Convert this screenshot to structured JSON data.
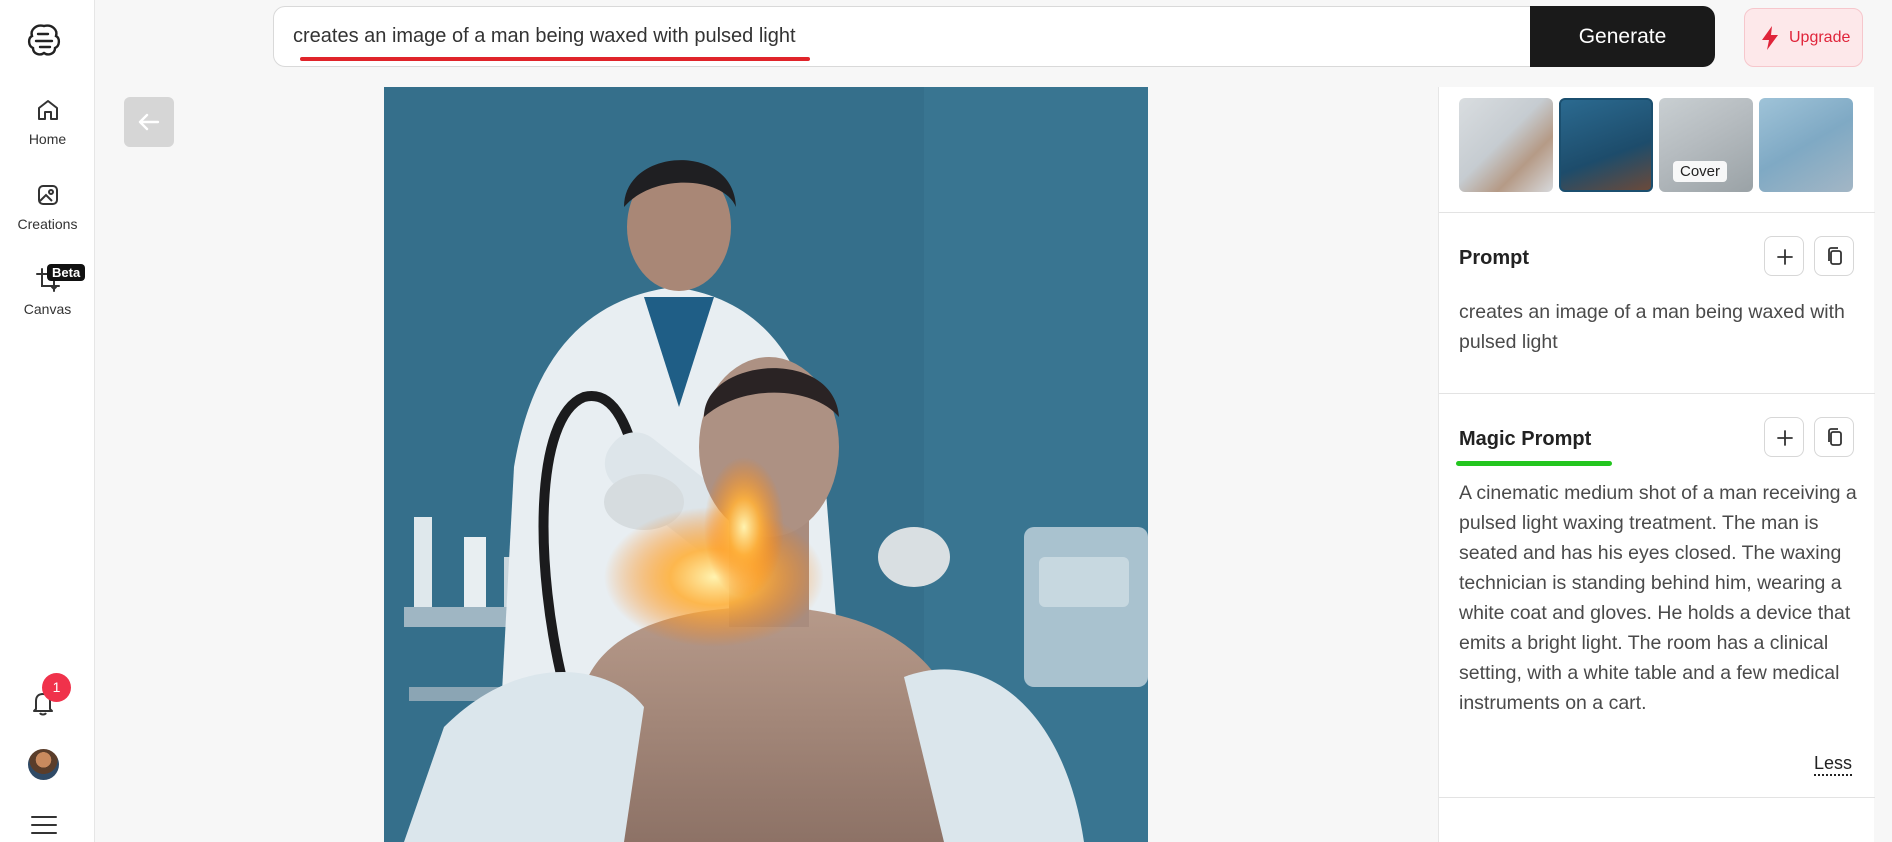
{
  "sidebar": {
    "logo_icon": "brain-logo-icon",
    "items": [
      {
        "label": "Home",
        "icon": "home-icon"
      },
      {
        "label": "Creations",
        "icon": "image-icon"
      },
      {
        "label": "Canvas",
        "icon": "crop-icon",
        "badge": "Beta"
      }
    ],
    "notification_count": "1"
  },
  "search": {
    "value": "creates an image of a man being waxed with pulsed light",
    "generate_label": "Generate",
    "upgrade_label": "Upgrade"
  },
  "thumbnails": {
    "cover_label": "Cover"
  },
  "prompt": {
    "title": "Prompt",
    "text": "creates an image of a man being waxed with pulsed light"
  },
  "magic_prompt": {
    "title": "Magic Prompt",
    "text": "A cinematic medium shot of a man receiving a pulsed light waxing treatment. The man is seated and has his eyes closed. The waxing technician is standing behind him, wearing a white coat and gloves. He holds a device that emits a bright light. The room has a clinical setting, with a white table and a few medical instruments on a cart.",
    "less_label": "Less"
  },
  "colors": {
    "accent_red": "#e0242a",
    "accent_green": "#23c51f",
    "generate_bg": "#1a1a1a",
    "upgrade_bg": "#fde8ea",
    "badge_red": "#f0324b"
  }
}
